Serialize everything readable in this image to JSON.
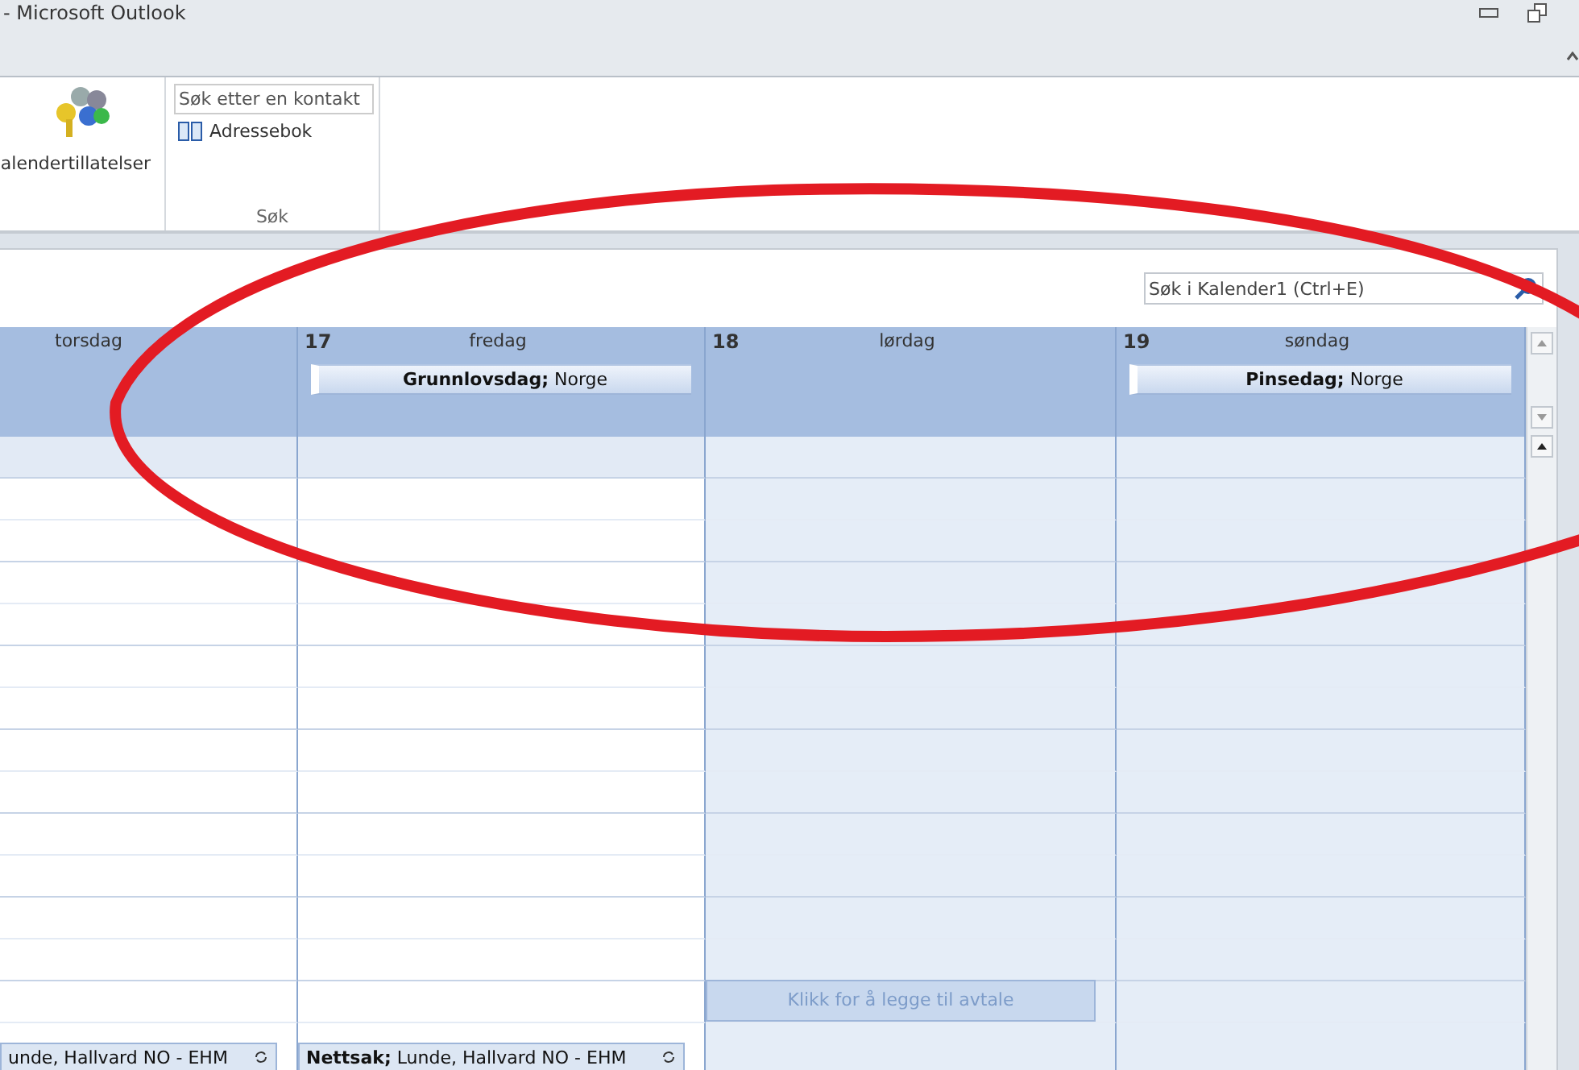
{
  "window": {
    "title": "- Microsoft Outlook"
  },
  "ribbon": {
    "groups": [
      {
        "kind": "permissions",
        "button": "alendertillatelser"
      },
      {
        "kind": "search",
        "field_placeholder": "Søk etter en kontakt",
        "button": "Adressebok",
        "label": "Søk"
      }
    ]
  },
  "calendar": {
    "search": {
      "placeholder": "Søk i Kalender1 (Ctrl+E)"
    },
    "days": [
      {
        "name": "torsdag",
        "weekend": false,
        "appointments": [
          "unde, Hallvard NO - EHM"
        ]
      },
      {
        "number": "17",
        "name": "fredag",
        "weekend": false,
        "holiday": "**Grunnlovsdag;** Norge",
        "appointments": [
          "**Nettsak;** Lunde, Hallvard NO - EHM"
        ]
      },
      {
        "number": "18",
        "name": "lørdag",
        "weekend": true,
        "add_prompt": "Klikk for å legge til avtale"
      },
      {
        "number": "19",
        "name": "søndag",
        "weekend": true,
        "holiday": "**Pinsedag;** Norge"
      }
    ]
  }
}
